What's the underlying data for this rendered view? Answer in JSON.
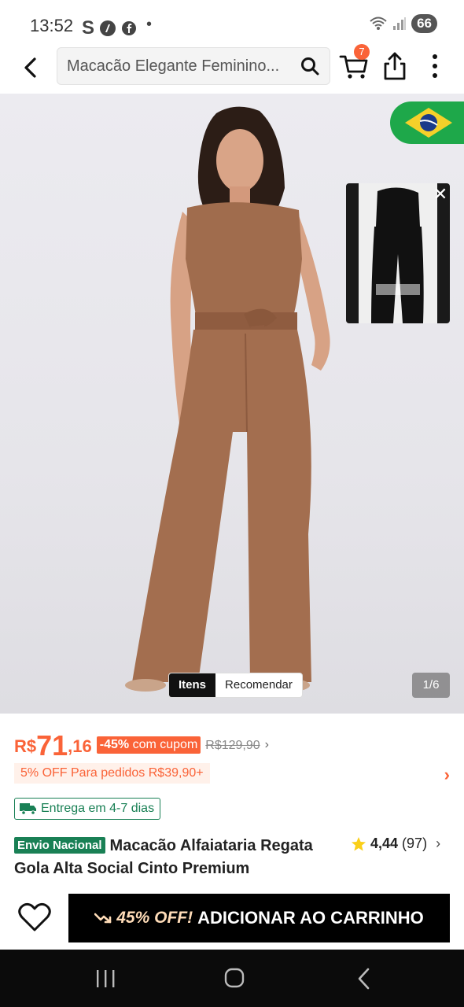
{
  "status_bar": {
    "time": "13:52",
    "battery": "66"
  },
  "header": {
    "search_text": "Macacão Elegante Feminino...",
    "cart_count": "7"
  },
  "gallery": {
    "tabs": [
      "Itens",
      "Recomendar"
    ],
    "active_tab": "Itens",
    "image_counter": "1/6"
  },
  "price": {
    "currency": "R$",
    "integer": "71",
    "decimal": ",16",
    "discount_percent": "-45%",
    "discount_suffix": "com cupom",
    "original": "R$129,90",
    "accent_color": "#fa6338"
  },
  "promo": {
    "text": "5% OFF Para pedidos R$39,90+"
  },
  "delivery": {
    "text": "Entrega em 4-7 dias",
    "color": "#198055"
  },
  "product": {
    "badge": "Envio Nacional",
    "title": "Macacão Alfaiataria Regata Gola Alta Social Cinto Premium",
    "rating": "4,44",
    "reviews": "(97)"
  },
  "actions": {
    "deal": "45% OFF!",
    "add_to_cart": "ADICIONAR AO CARRINHO"
  }
}
